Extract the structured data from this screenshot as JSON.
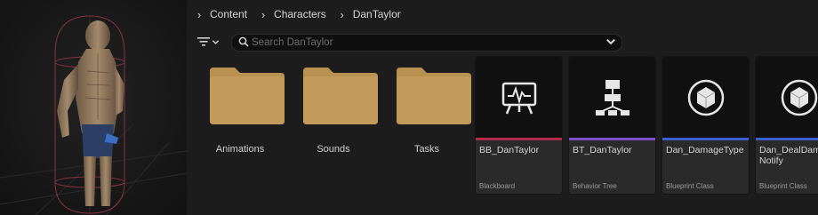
{
  "breadcrumb": {
    "items": [
      "Content",
      "Characters",
      "DanTaylor"
    ]
  },
  "search": {
    "placeholder": "Search DanTaylor"
  },
  "folders": [
    {
      "label": "Animations"
    },
    {
      "label": "Sounds"
    },
    {
      "label": "Tasks"
    }
  ],
  "assets": [
    {
      "name": "BB_DanTaylor",
      "type": "Blackboard",
      "icon": "blackboard-icon",
      "accent": "#b3294a"
    },
    {
      "name": "BT_DanTaylor",
      "type": "Behavior Tree",
      "icon": "behavior-tree-icon",
      "accent": "#7d4fc9"
    },
    {
      "name": "Dan_DamageType",
      "type": "Blueprint Class",
      "icon": "blueprint-class-icon",
      "accent": "#3a5fd0"
    },
    {
      "name": "Dan_DealDama Notify",
      "type": "Blueprint Class",
      "icon": "blueprint-class-icon",
      "accent": "#3a5fd0"
    }
  ],
  "colors": {
    "folder": "#c29a5a",
    "panel": "#1c1c1c",
    "tile": "#2a2a2a"
  }
}
